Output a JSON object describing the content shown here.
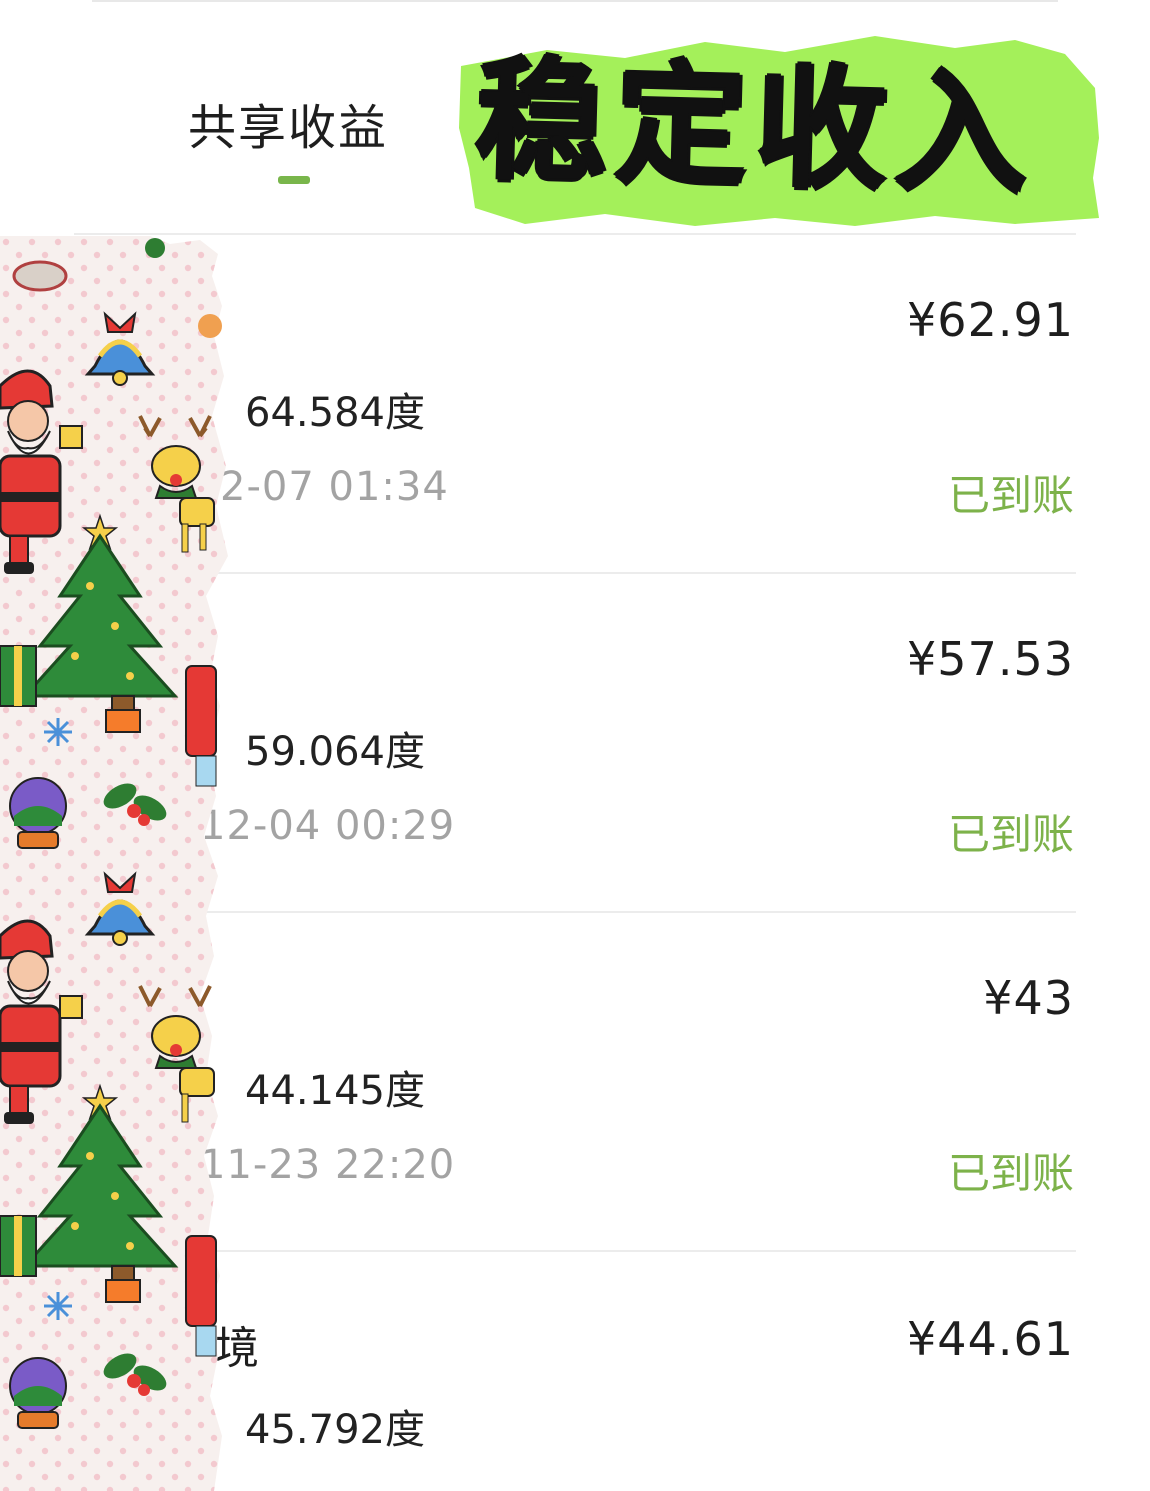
{
  "header": {
    "tab_label": "共享收益",
    "banner_text": "稳定收入",
    "accent_color": "#79b64b",
    "banner_color": "#a4f05a"
  },
  "records": [
    {
      "name": "",
      "amount": "¥62.91",
      "kwh": "64.584度",
      "time": "2-07 01:34",
      "status": "已到账"
    },
    {
      "name": "",
      "amount": "¥57.53",
      "kwh": "59.064度",
      "time": "12-04 00:29",
      "status": "已到账"
    },
    {
      "name": "",
      "amount": "¥43",
      "kwh": "44.145度",
      "time": "11-23 22:20",
      "status": "已到账"
    },
    {
      "name": "境",
      "amount": "¥44.61",
      "kwh": "45.792度",
      "time": "",
      "status": ""
    }
  ],
  "decoration": {
    "sticker_theme": "christmas-pattern",
    "icons": [
      "santa-icon",
      "bell-icon",
      "reindeer-icon",
      "christmas-tree-icon",
      "gift-icon",
      "snowflake-icon",
      "snow-globe-icon",
      "holly-icon"
    ]
  }
}
